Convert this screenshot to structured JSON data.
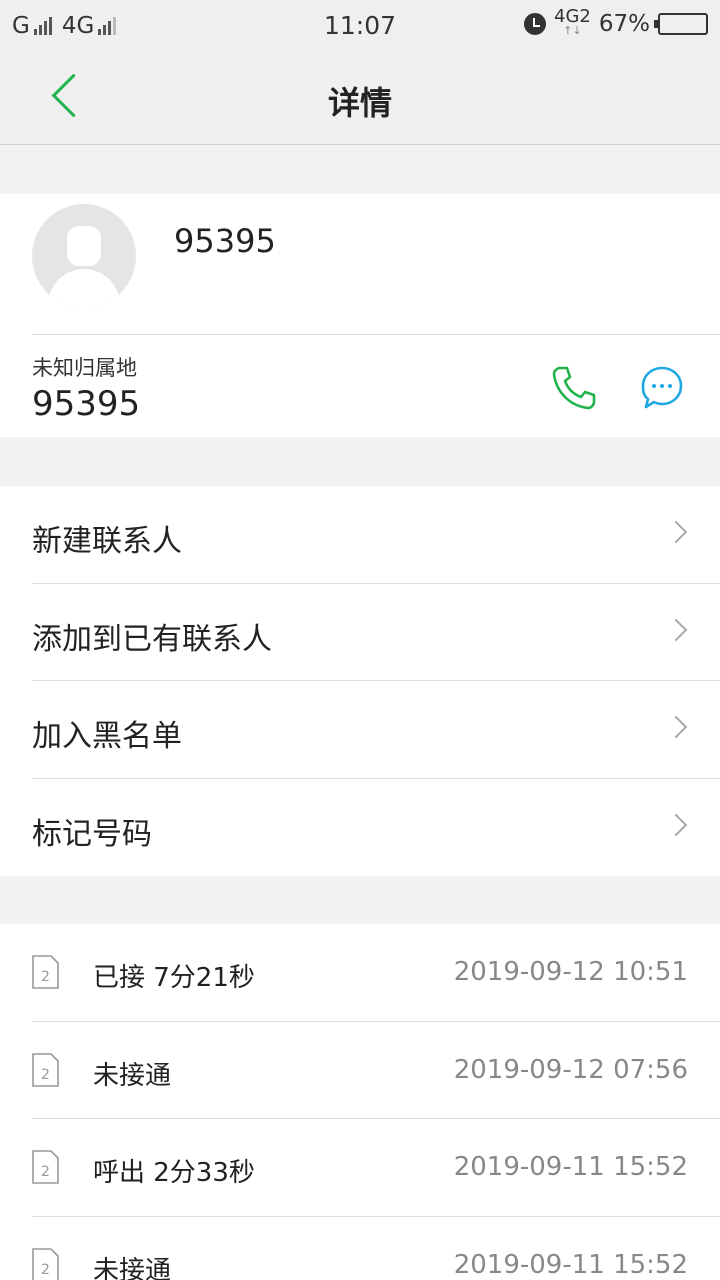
{
  "status_bar": {
    "carrier1": "G",
    "carrier2": "4G",
    "time": "11:07",
    "network2": "4G",
    "network2_sub": "2",
    "battery": "67%",
    "battery_level": 0.67
  },
  "header": {
    "title": "详情"
  },
  "contact": {
    "name": "95395",
    "location": "未知归属地",
    "number": "95395"
  },
  "menu": {
    "items": [
      {
        "label": "新建联系人"
      },
      {
        "label": "添加到已有联系人"
      },
      {
        "label": "加入黑名单"
      },
      {
        "label": "标记号码"
      }
    ]
  },
  "call_log": [
    {
      "sim": "2",
      "desc": "已接  7分21秒",
      "time": "2019-09-12  10:51"
    },
    {
      "sim": "2",
      "desc": "未接通",
      "time": "2019-09-12  07:56"
    },
    {
      "sim": "2",
      "desc": "呼出  2分33秒",
      "time": "2019-09-11  15:52"
    },
    {
      "sim": "2",
      "desc": "未接通",
      "time": "2019-09-11  15:52"
    }
  ],
  "colors": {
    "accent_green": "#21b34b",
    "accent_blue": "#1ea7e1"
  }
}
